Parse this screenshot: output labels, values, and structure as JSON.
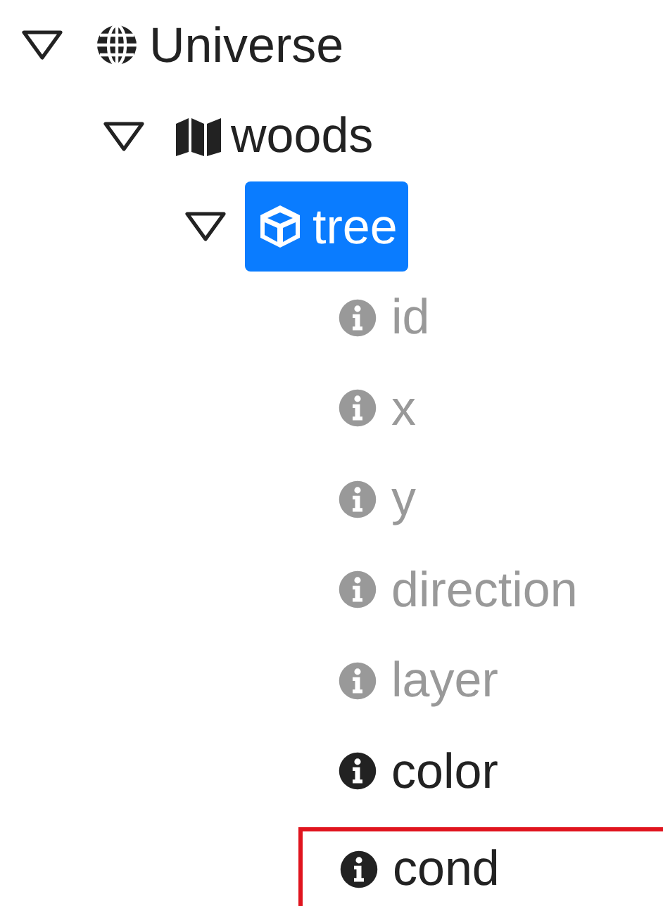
{
  "tree": [
    {
      "label": "Universe",
      "kind": "globe",
      "expanded": true,
      "selected": false,
      "children": [
        {
          "label": "woods",
          "kind": "map",
          "expanded": true,
          "selected": false,
          "children": [
            {
              "label": "tree",
              "kind": "cube",
              "expanded": true,
              "selected": true,
              "children": [
                {
                  "label": "id",
                  "kind": "info",
                  "disabled": true,
                  "outlined": false,
                  "selected": false
                },
                {
                  "label": "x",
                  "kind": "info",
                  "disabled": true,
                  "outlined": false,
                  "selected": false
                },
                {
                  "label": "y",
                  "kind": "info",
                  "disabled": true,
                  "outlined": false,
                  "selected": false
                },
                {
                  "label": "direction",
                  "kind": "info",
                  "disabled": true,
                  "outlined": false,
                  "selected": false
                },
                {
                  "label": "layer",
                  "kind": "info",
                  "disabled": true,
                  "outlined": false,
                  "selected": false
                },
                {
                  "label": "color",
                  "kind": "info",
                  "disabled": false,
                  "outlined": false,
                  "selected": false
                },
                {
                  "label": "cond",
                  "kind": "info",
                  "disabled": false,
                  "outlined": true,
                  "selected": false
                }
              ]
            }
          ]
        }
      ]
    }
  ]
}
